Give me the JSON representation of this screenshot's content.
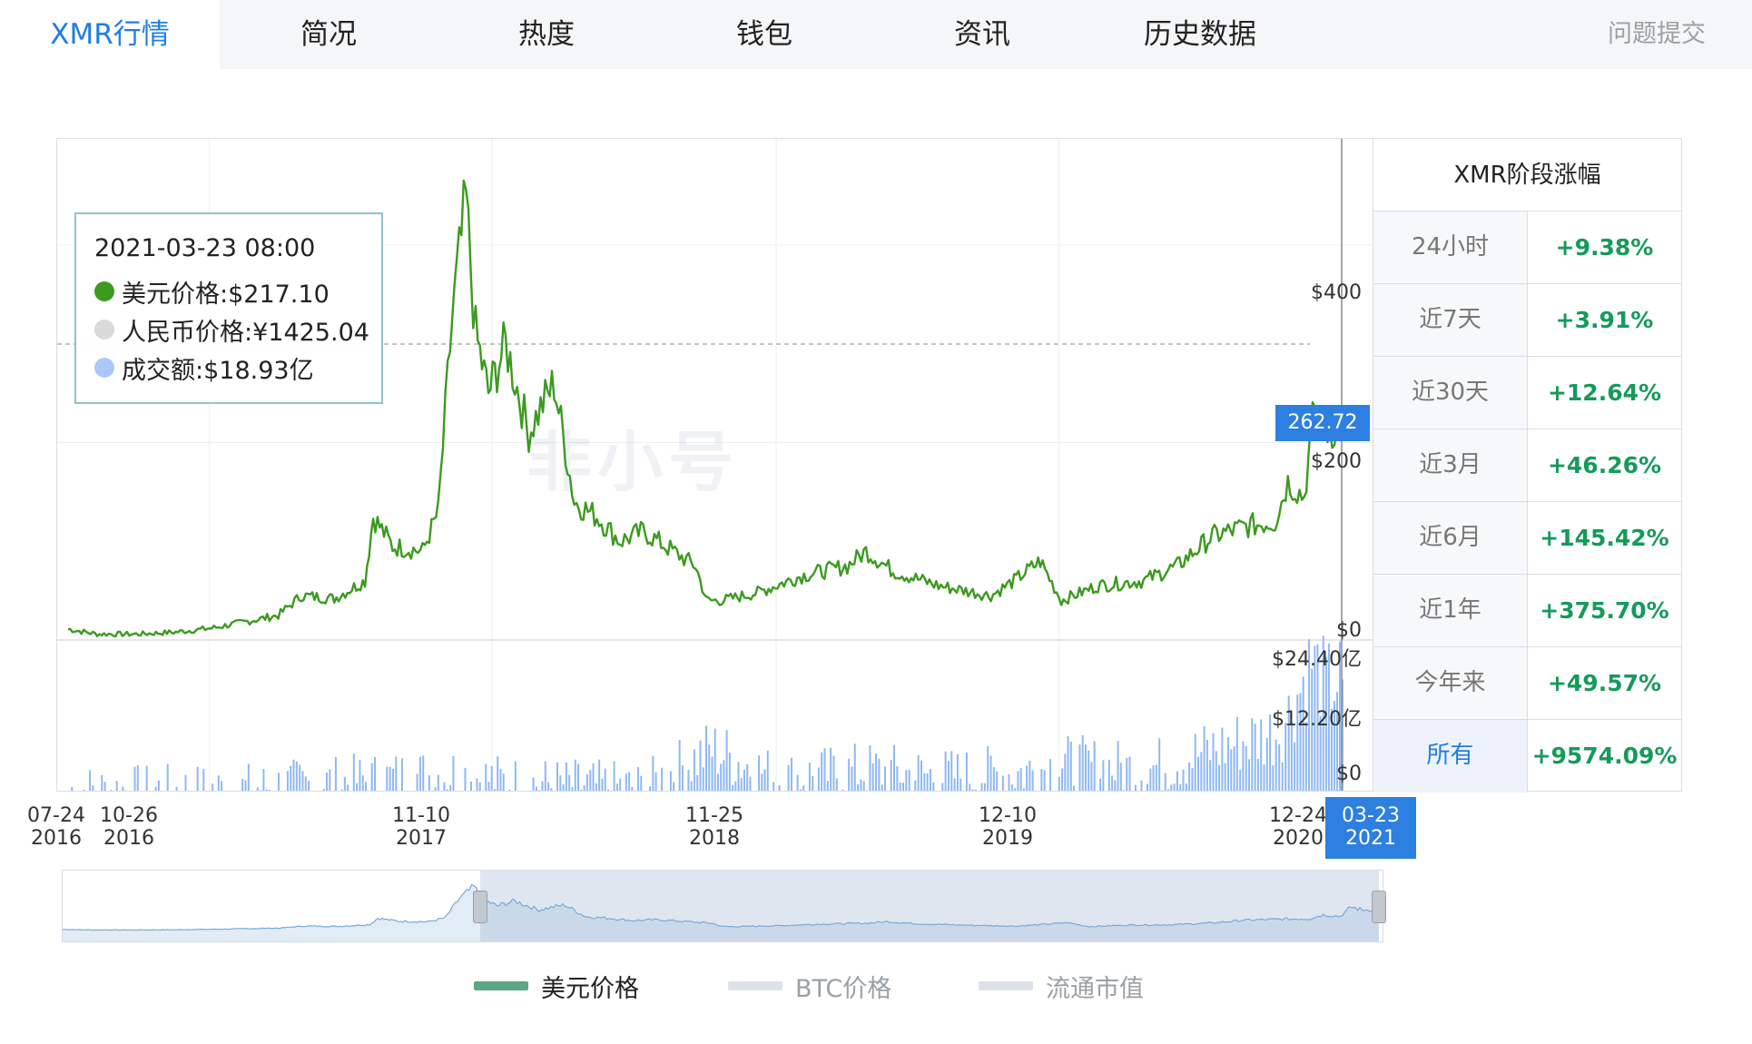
{
  "tabs": [
    {
      "label": "XMR行情",
      "active": true
    },
    {
      "label": "简况"
    },
    {
      "label": "热度"
    },
    {
      "label": "钱包"
    },
    {
      "label": "资讯"
    },
    {
      "label": "历史数据"
    }
  ],
  "report_label": "问题提交",
  "watermark": "非小号",
  "tooltip": {
    "time": "2021-03-23 08:00",
    "usd_price": "美元价格:$217.10",
    "cny_price": "人民币价格:¥1425.04",
    "volume": "成交额:$18.93亿"
  },
  "price_tag": "262.72",
  "stats": {
    "title": "XMR阶段涨幅",
    "rows": [
      {
        "label": "24小时",
        "value": "+9.38%"
      },
      {
        "label": "近7天",
        "value": "+3.91%"
      },
      {
        "label": "近30天",
        "value": "+12.64%"
      },
      {
        "label": "近3月",
        "value": "+46.26%"
      },
      {
        "label": "近6月",
        "value": "+145.42%"
      },
      {
        "label": "近1年",
        "value": "+375.70%"
      },
      {
        "label": "今年来",
        "value": "+49.57%"
      },
      {
        "label": "所有",
        "value": "+9574.09%",
        "selected": true
      }
    ]
  },
  "legend": [
    {
      "label": "美元价格",
      "color": "#5aa882",
      "active": true
    },
    {
      "label": "BTC价格",
      "color": "#dde1ea",
      "active": false
    },
    {
      "label": "流通市值",
      "color": "#dde1ea",
      "active": false
    }
  ],
  "colors": {
    "price_line": "#3c9a1f",
    "volume_bar": "#8fb8f2",
    "accent": "#1f7de6",
    "positive": "#169a5a"
  },
  "chart_data": {
    "type": "line",
    "x_tick_labels": [
      "07-24\n2016",
      "10-26\n2016",
      "11-10\n2017",
      "11-25\n2018",
      "12-10\n2019",
      "12-24\n2020",
      "03-23\n2021"
    ],
    "y_price_ticks": [
      "$400",
      "$200",
      "$0"
    ],
    "y_volume_ticks": [
      "$24.40亿",
      "$12.20亿",
      "$0"
    ],
    "ylim_price": [
      0,
      480
    ],
    "ylim_volume_yi": [
      0,
      24.4
    ],
    "series": [
      {
        "name": "美元价格",
        "x": [
          "2016-07-24",
          "2016-09-01",
          "2016-10-26",
          "2016-12-15",
          "2017-02-01",
          "2017-03-15",
          "2017-05-01",
          "2017-06-01",
          "2017-07-15",
          "2017-08-25",
          "2017-09-05",
          "2017-10-01",
          "2017-11-10",
          "2017-12-01",
          "2017-12-20",
          "2018-01-07",
          "2018-01-20",
          "2018-02-06",
          "2018-03-01",
          "2018-04-01",
          "2018-04-20",
          "2018-05-05",
          "2018-06-01",
          "2018-07-01",
          "2018-08-01",
          "2018-09-01",
          "2018-10-01",
          "2018-11-10",
          "2018-11-25",
          "2018-12-15",
          "2019-02-01",
          "2019-04-01",
          "2019-06-01",
          "2019-06-26",
          "2019-08-01",
          "2019-10-01",
          "2019-12-10",
          "2020-01-10",
          "2020-02-14",
          "2020-03-13",
          "2020-05-01",
          "2020-07-01",
          "2020-08-15",
          "2020-10-01",
          "2020-11-15",
          "2020-12-24",
          "2021-01-10",
          "2021-02-01",
          "2021-02-15",
          "2021-03-01",
          "2021-03-23"
        ],
        "values": [
          11,
          6,
          6,
          8,
          12,
          18,
          25,
          45,
          42,
          60,
          125,
          95,
          90,
          130,
          330,
          445,
          310,
          250,
          300,
          210,
          240,
          260,
          140,
          125,
          100,
          110,
          95,
          75,
          40,
          40,
          48,
          65,
          75,
          90,
          70,
          55,
          45,
          60,
          80,
          40,
          55,
          60,
          75,
          105,
          115,
          120,
          160,
          145,
          240,
          210,
          217
        ]
      },
      {
        "name": "成交额",
        "x": [
          "2016-07-24",
          "2017-03-01",
          "2017-08-25",
          "2017-12-20",
          "2018-03-01",
          "2018-09-01",
          "2018-12-01",
          "2019-03-01",
          "2019-06-26",
          "2019-10-01",
          "2020-01-10",
          "2020-03-13",
          "2020-07-01",
          "2020-10-01",
          "2020-12-24",
          "2021-01-10",
          "2021-02-10",
          "2021-03-01",
          "2021-03-23"
        ],
        "values": [
          0.1,
          0.3,
          1.8,
          3.0,
          1.5,
          0.5,
          7.0,
          2.0,
          3.5,
          2.5,
          3.0,
          4.5,
          3.5,
          7.0,
          10.0,
          13.0,
          22.0,
          18.0,
          18.93
        ]
      }
    ]
  }
}
